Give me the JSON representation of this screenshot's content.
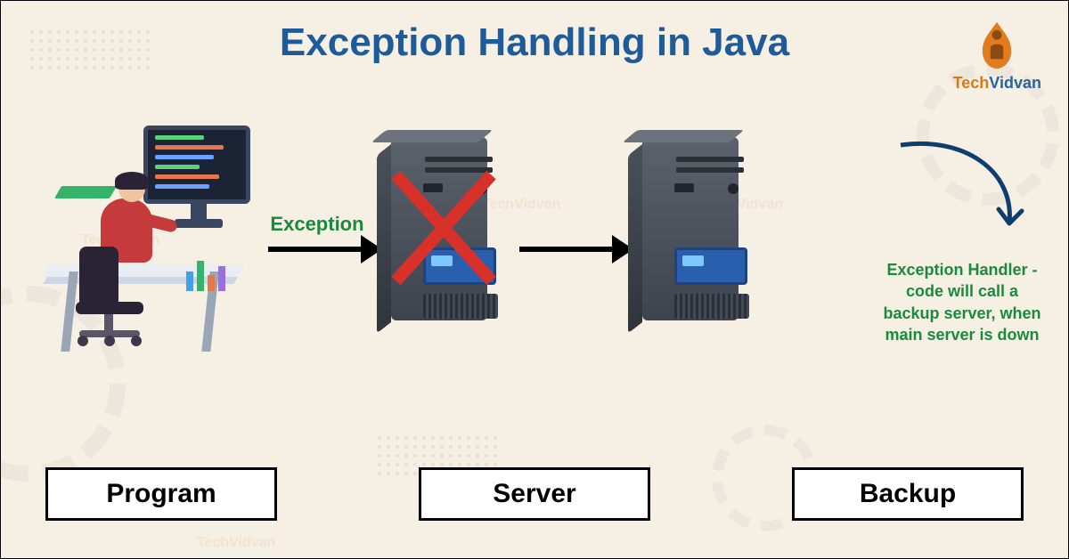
{
  "title": "Exception Handling in Java",
  "logo": {
    "tech": "Tech",
    "vidvan": "Vidvan"
  },
  "arrow_label": "Exception",
  "handler_text": "Exception Handler - code will call a backup server, when main server is down",
  "labels": {
    "program": "Program",
    "server": "Server",
    "backup": "Backup"
  },
  "watermark": "TechVidvan",
  "colors": {
    "title": "#1d5b99",
    "accent_green": "#1a8a3c",
    "cross_red": "#d8312a"
  }
}
